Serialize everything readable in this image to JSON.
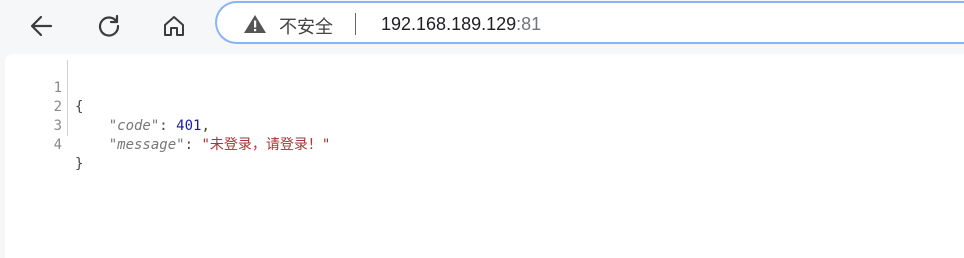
{
  "toolbar": {
    "back_icon": "arrow-left-icon",
    "reload_icon": "reload-icon",
    "home_icon": "home-icon"
  },
  "omnibox": {
    "security_icon": "warning-triangle-icon",
    "security_text": "不安全",
    "url_host": "192.168.189.129",
    "url_port": ":81"
  },
  "json_viewer": {
    "lines": [
      {
        "number": "1",
        "open": "{"
      },
      {
        "number": "2",
        "key": "\"code\"",
        "sep": ": ",
        "value": "401",
        "trail": ","
      },
      {
        "number": "3",
        "key": "\"message\"",
        "sep": ": ",
        "value": "\"未登录，请登录！\""
      },
      {
        "number": "4",
        "close": "}"
      }
    ]
  },
  "colors": {
    "omnibox_border": "#8ab4f8",
    "number_value": "#1a1aa6",
    "string_value": "#a33333"
  }
}
